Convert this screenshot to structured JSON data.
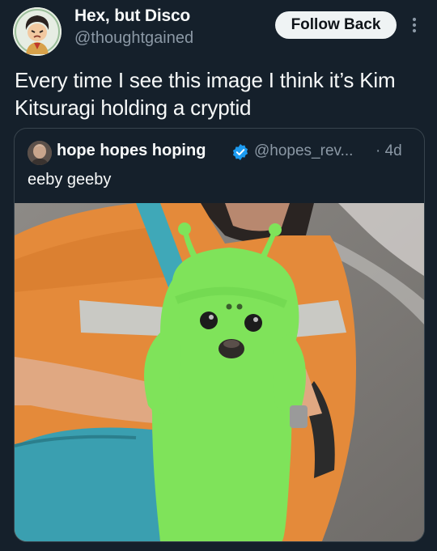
{
  "author": {
    "display_name": "Hex, but Disco",
    "handle": "@thoughtgained",
    "avatar_icon": "cartoon-character-avatar"
  },
  "actions": {
    "follow_back_label": "Follow Back",
    "more_icon": "vertical-ellipsis-icon"
  },
  "tweet": {
    "text": "Every time I see this image I think it’s Kim Kitsuragi holding a cryptid"
  },
  "quoted": {
    "display_name": "hope hopes hoping",
    "handle": "@hopes_rev...",
    "time": "· 4d",
    "text": "eeby  geeby",
    "verified_icon": "verified-badge-icon",
    "media_icon": "green-plush-creature-photo"
  },
  "colors": {
    "background": "#15202b",
    "text_primary": "#f7f9f9",
    "text_secondary": "#8b98a5",
    "border": "#38444d",
    "verified": "#1d9bf0",
    "button_bg": "#eff3f4"
  }
}
